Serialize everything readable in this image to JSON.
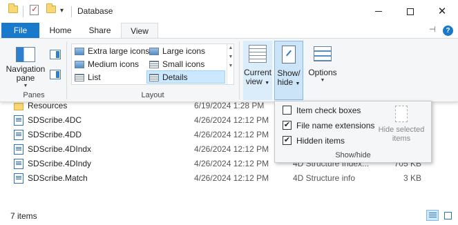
{
  "window": {
    "title": "Database"
  },
  "ribbon_tabs": [
    {
      "label": "File"
    },
    {
      "label": "Home"
    },
    {
      "label": "Share"
    },
    {
      "label": "View"
    }
  ],
  "panes": {
    "navigation_pane_line1": "Navigation",
    "navigation_pane_line2": "pane",
    "group_label": "Panes"
  },
  "layout": {
    "items": [
      {
        "label": "Extra large icons"
      },
      {
        "label": "Large icons"
      },
      {
        "label": "Medium icons"
      },
      {
        "label": "Small icons"
      },
      {
        "label": "List"
      },
      {
        "label": "Details"
      }
    ],
    "selected": "Details",
    "group_label": "Layout"
  },
  "current_view": {
    "line1": "Current",
    "line2": "view"
  },
  "show_hide": {
    "line1": "Show/",
    "line2": "hide"
  },
  "options": {
    "label": "Options"
  },
  "popup": {
    "checkboxes": [
      {
        "label": "Item check boxes",
        "checked": false,
        "mark": ""
      },
      {
        "label": "File name extensions",
        "checked": true,
        "mark": "✔"
      },
      {
        "label": "Hidden items",
        "checked": true,
        "mark": "✔"
      }
    ],
    "hide_selected_line1": "Hide selected",
    "hide_selected_line2": "items",
    "group_label": "Show/hide"
  },
  "files": [
    {
      "name": "Resources",
      "date": "6/19/2024 1:28 PM",
      "type": "",
      "size": "",
      "icon": "folder-icon"
    },
    {
      "name": "SDScribe.4DC",
      "date": "4/26/2024 12:12 PM",
      "type": "",
      "size": "",
      "icon": "structure-file-icon"
    },
    {
      "name": "SDScribe.4DD",
      "date": "4/26/2024 12:12 PM",
      "type": "",
      "size": "",
      "icon": "structure-file-icon"
    },
    {
      "name": "SDScribe.4DIndx",
      "date": "4/26/2024 12:12 PM",
      "type": "",
      "size": "",
      "icon": "structure-file-icon"
    },
    {
      "name": "SDScribe.4DIndy",
      "date": "4/26/2024 12:12 PM",
      "type": "4D Structure Index...",
      "size": "705 KB",
      "icon": "structure-file-icon"
    },
    {
      "name": "SDScribe.Match",
      "date": "4/26/2024 12:12 PM",
      "type": "4D Structure info",
      "size": "3 KB",
      "icon": "structure-file-icon"
    }
  ],
  "status": {
    "item_count": "7 items"
  },
  "colors": {
    "accent": "#1979ca",
    "selection": "#cce8ff",
    "ribbon_bg": "#f5f6f7"
  }
}
